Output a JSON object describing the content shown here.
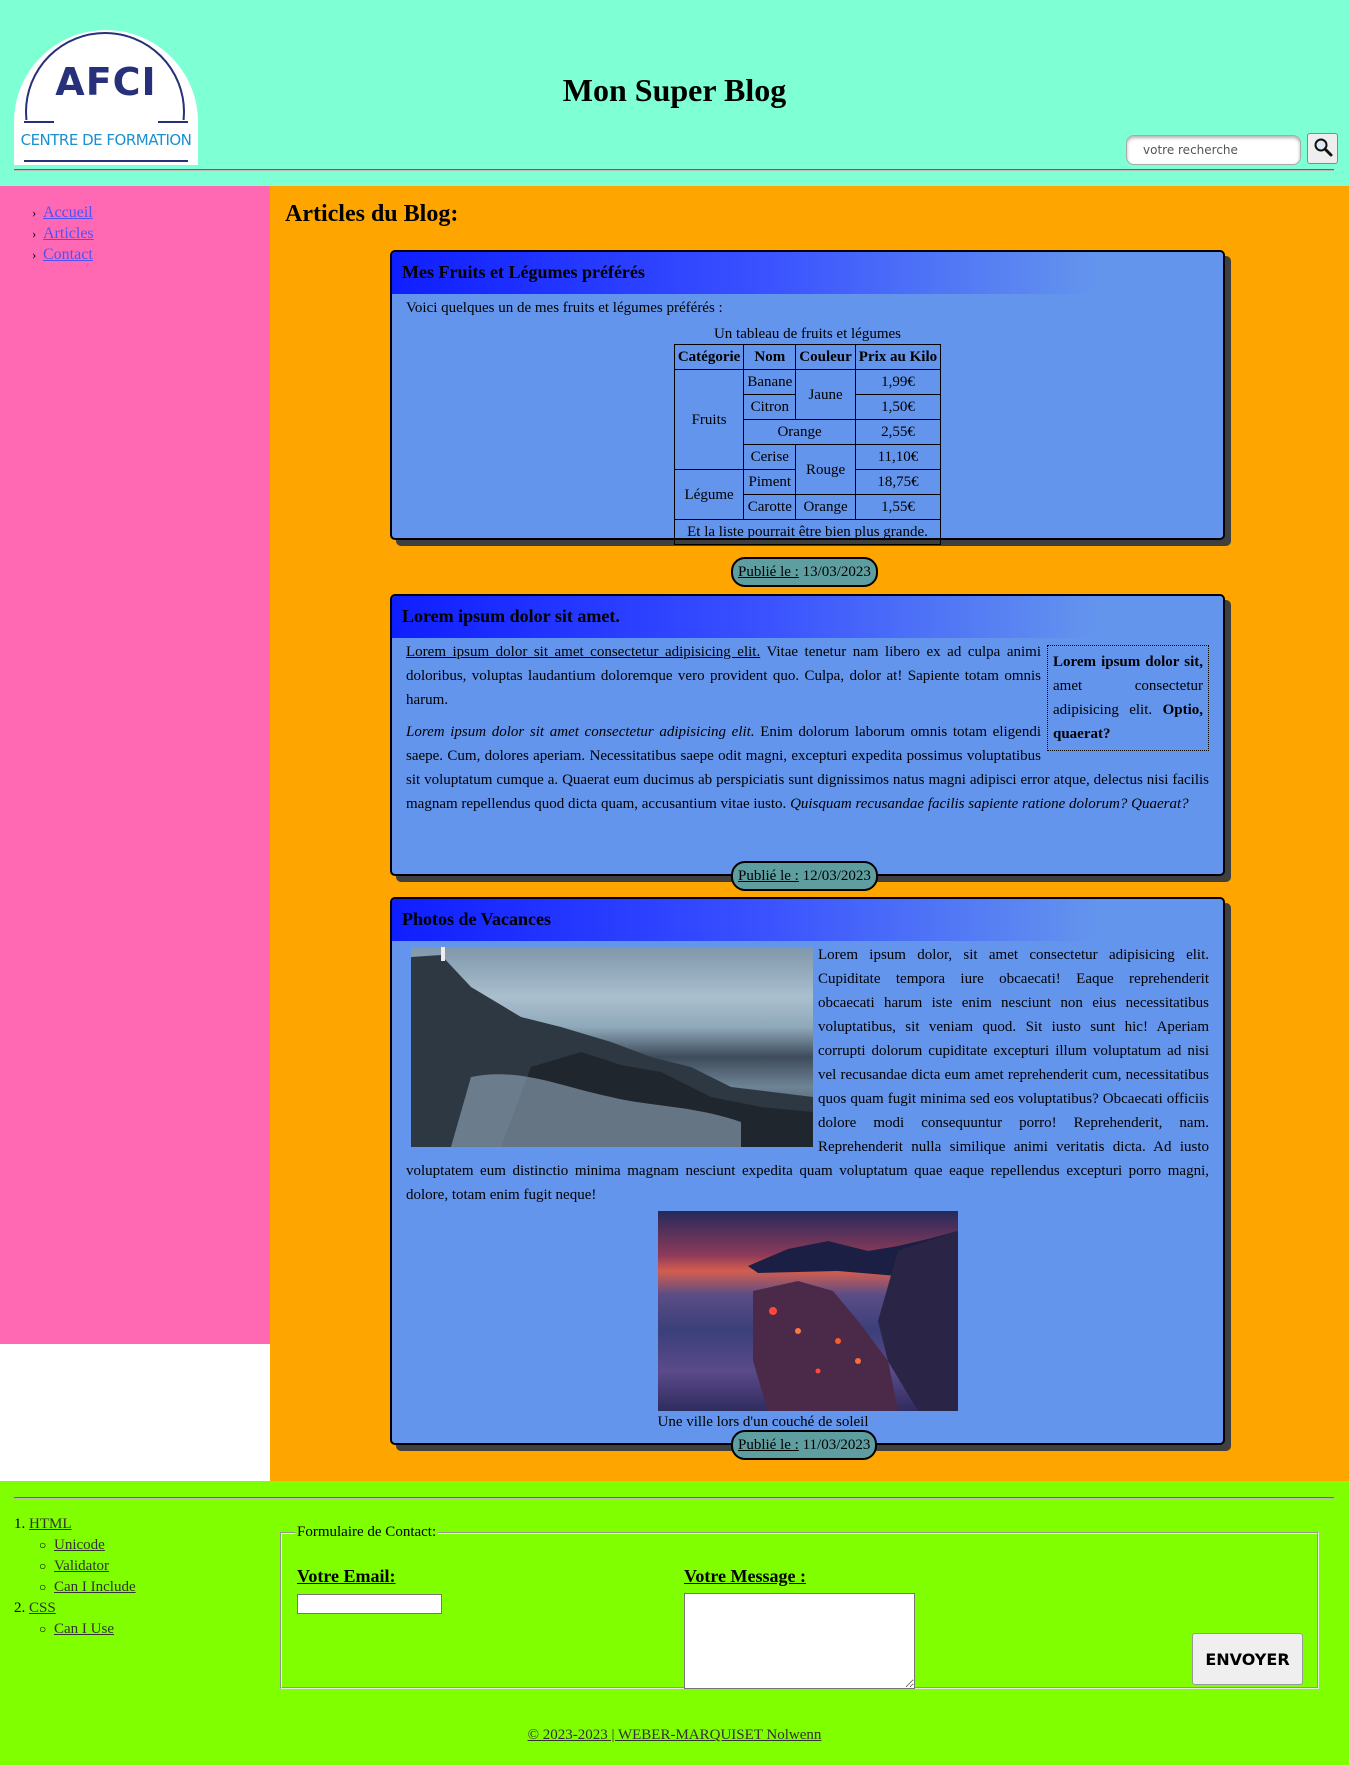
{
  "header": {
    "logo_line1": "AFCI",
    "logo_line2": "CENTRE DE FORMATION",
    "title": "Mon Super Blog",
    "search_placeholder": "votre recherche"
  },
  "nav": {
    "items": [
      {
        "label": "Accueil"
      },
      {
        "label": "Articles"
      },
      {
        "label": "Contact"
      }
    ]
  },
  "main": {
    "heading": "Articles du Blog:",
    "articles": [
      {
        "title": "Mes Fruits et Légumes préférés",
        "intro": "Voici quelques un de mes fruits et légumes préférés :",
        "published_label": "Publié le :",
        "published_date": "13/03/2023",
        "table": {
          "caption": "Un tableau de fruits et légumes",
          "headers": [
            "Catégorie",
            "Nom",
            "Couleur",
            "Prix au Kilo"
          ],
          "cat_fruits": "Fruits",
          "cat_legume": "Légume",
          "rows": [
            {
              "nom": "Banane",
              "prix": "1,99€"
            },
            {
              "nom": "Citron",
              "prix": "1,50€"
            },
            {
              "nom": "Orange",
              "prix": "2,55€"
            },
            {
              "nom": "Cerise",
              "prix": "11,10€"
            },
            {
              "nom": "Piment",
              "prix": "18,75€"
            },
            {
              "nom": "Carotte",
              "prix": "1,55€"
            }
          ],
          "color_jaune": "Jaune",
          "color_rouge": "Rouge",
          "color_orange": "Orange",
          "footer": "Et la liste pourrait être bien plus grande."
        }
      },
      {
        "title": "Lorem ipsum dolor sit amet.",
        "p1_link": "Lorem ipsum dolor sit amet consectetur adipisicing elit.",
        "p1_text": " Vitae tenetur nam libero ex ad culpa animi doloribus, voluptas laudantium doloremque vero provident quo. Culpa, dolor at! Sapiente totam omnis harum.",
        "aside_bold1": "Lorem ipsum dolor sit,",
        "aside_text": " amet consectetur adipisicing elit. ",
        "aside_bold2": "Optio, quaerat?",
        "p2_italic": "Lorem ipsum dolor sit amet consectetur adipisicing elit.",
        "p2_text": " Enim dolorum laborum omnis totam eligendi saepe. Cum, dolores aperiam. Necessitatibus saepe odit magni, excepturi expedita possimus voluptatibus sit voluptatum cumque a. Quaerat eum ducimus ab perspiciatis sunt dignissimos natus magni adipisci error atque, delectus nisi facilis magnam repellendus quod dicta quam, accusantium vitae iusto. ",
        "p2_italic_end": "Quisquam recusandae facilis sapiente ratione dolorum? Quaerat?",
        "published_label": "Publié le :",
        "published_date": "12/03/2023"
      },
      {
        "title": "Photos de Vacances",
        "text": "Lorem ipsum dolor, sit amet consectetur adipisicing elit. Cupiditate tempora iure obcaecati! Eaque reprehenderit obcaecati harum iste enim nesciunt non eius necessitatibus voluptatibus, sit veniam quod. Sit iusto sunt hic! Aperiam corrupti dolorum cupiditate excepturi illum voluptatum ad nisi vel recusandae dicta eum amet reprehenderit cum, necessitatibus quos quam fugit minima sed eos voluptatibus? Obcaecati officiis dolore modi consequuntur porro! Reprehenderit, nam. Reprehenderit nulla similique animi veritatis dicta. Ad iusto voluptatem eum distinctio minima magnam nesciunt expedita quam voluptatum quae eaque repellendus excepturi porro magni, dolore, totam enim fugit neque!",
        "caption": "Une ville lors d'un couché de soleil",
        "published_label": "Publié le :",
        "published_date": "11/03/2023"
      }
    ]
  },
  "footer": {
    "list": [
      {
        "num": "1.",
        "label": "HTML",
        "sub": [
          "Unicode",
          "Validator",
          "Can I Include"
        ]
      },
      {
        "num": "2.",
        "label": "CSS",
        "sub": [
          "Can I Use"
        ]
      }
    ],
    "form": {
      "legend": "Formulaire de Contact:",
      "email_label": "Votre Email:",
      "message_label": "Votre Message :",
      "send_label": "ENVOYER"
    },
    "copyright": "© 2023-2023 | WEBER-MARQUISET Nolwenn"
  },
  "colors": {
    "header_bg": "#7fffd4",
    "sidebar_bg": "#ff69b4",
    "main_bg": "#ffa500",
    "article_bg": "#6495ed",
    "footer_bg": "#7fff00",
    "badge_bg": "#5f9ea0"
  },
  "icons": {
    "search": "magnifier-icon"
  }
}
